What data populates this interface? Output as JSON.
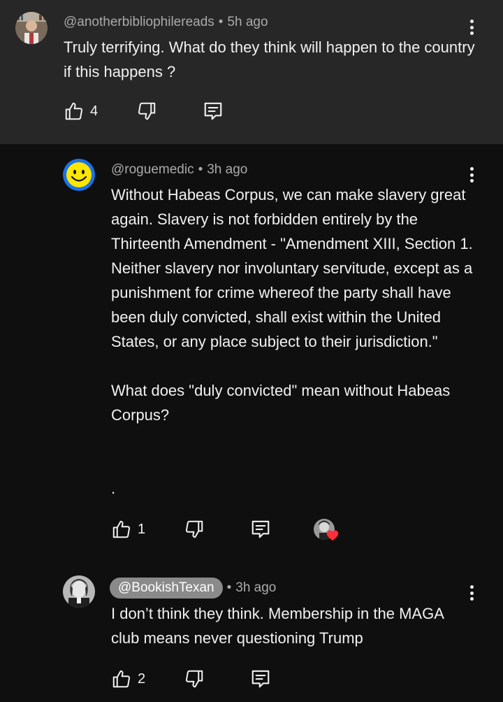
{
  "comments": [
    {
      "handle": "@anotherbibliophilereads",
      "time": "5h ago",
      "text": "Truly terrifying.  What do they think will happen to the country if this happens ?",
      "likes": "4"
    },
    {
      "handle": "@roguemedic",
      "time": "3h ago",
      "text": "Without Habeas Corpus, we can make slavery great again. Slavery is not forbidden entirely by the Thirteenth Amendment - \"Amendment XIII, Section 1. Neither slavery nor involuntary servitude, except as a punishment for crime whereof the party shall have been duly convicted, shall exist within the United States, or any place subject to their jurisdiction.\"\n\nWhat does \"duly convicted\" mean without Habeas Corpus?\n\n\n.",
      "likes": "1"
    },
    {
      "handle": "@BookishTexan",
      "time": "3h ago",
      "text": "I don’t think they think. Membership in the MAGA club means never questioning Trump",
      "likes": "2"
    }
  ],
  "icons": {
    "like": "thumb-up-icon",
    "dislike": "thumb-down-icon",
    "reply": "reply-icon",
    "menu": "more-vert-icon",
    "heart": "heart-icon"
  },
  "colors": {
    "background": "#0f0f0f",
    "highlight": "#272727",
    "text": "#f1f1f1",
    "meta": "#aaaaaa",
    "chip": "#8a8a8a",
    "heart": "#ff2e3a",
    "smiley": "#ffe600",
    "smiley_ring": "#1a73e8"
  },
  "sep": "•"
}
